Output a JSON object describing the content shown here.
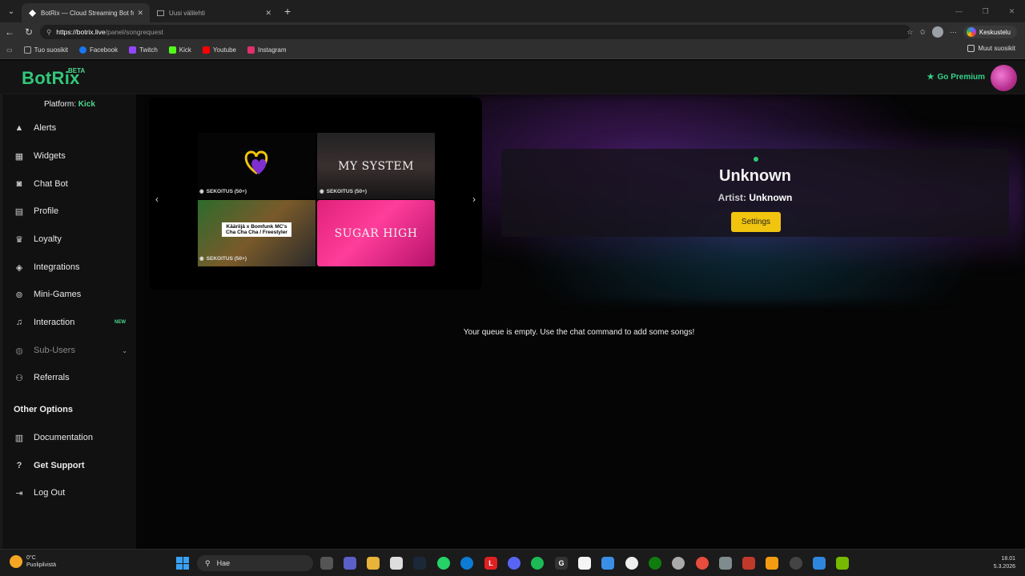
{
  "browser": {
    "tabs": [
      {
        "label": "BotRix — Cloud Streaming Bot for",
        "active": true
      },
      {
        "label": "Uusi välilehti",
        "active": false
      }
    ],
    "url_host": "https://botrix.live",
    "url_path": "/panel/songrequest",
    "chat_button": "Keskustelu",
    "bookmarks": [
      {
        "label": "Tuo suosikit",
        "icon": "import-icon",
        "color": "#aaaaaa"
      },
      {
        "label": "Facebook",
        "icon": "facebook-icon",
        "color": "#1877f2"
      },
      {
        "label": "Twitch",
        "icon": "twitch-icon",
        "color": "#9146ff"
      },
      {
        "label": "Kick",
        "icon": "kick-icon",
        "color": "#53fc18"
      },
      {
        "label": "Youtube",
        "icon": "youtube-icon",
        "color": "#ff0000"
      },
      {
        "label": "Instagram",
        "icon": "instagram-icon",
        "color": "#e1306c"
      }
    ],
    "other_bookmarks": "Muut suosikit"
  },
  "header": {
    "logo": "BotRix",
    "beta": "BETA",
    "premium": "Go Premium"
  },
  "sidebar": {
    "platform_label": "Platform:",
    "platform_value": "Kick",
    "items": [
      {
        "label": "Alerts",
        "icon": "warning-icon"
      },
      {
        "label": "Widgets",
        "icon": "grid-icon"
      },
      {
        "label": "Chat Bot",
        "icon": "robot-icon"
      },
      {
        "label": "Profile",
        "icon": "profile-card-icon"
      },
      {
        "label": "Loyalty",
        "icon": "trophy-icon"
      },
      {
        "label": "Integrations",
        "icon": "layers-icon"
      },
      {
        "label": "Mini-Games",
        "icon": "gamepad-icon"
      },
      {
        "label": "Interaction",
        "icon": "music-note-icon",
        "badge": "NEW"
      },
      {
        "label": "Sub-Users",
        "icon": "users-icon"
      },
      {
        "label": "Referrals",
        "icon": "people-icon"
      }
    ],
    "other_options_title": "Other Options",
    "other_items": [
      {
        "label": "Documentation",
        "icon": "book-icon"
      },
      {
        "label": "Get Support",
        "icon": "question-icon"
      },
      {
        "label": "Log Out",
        "icon": "logout-icon"
      }
    ]
  },
  "carousel": {
    "items": [
      {
        "caption": "SEKOITUS (50+)",
        "thumb_text": ""
      },
      {
        "caption": "SEKOITUS (50+)",
        "thumb_text": "MY SYSTEM"
      },
      {
        "caption": "SEKOITUS (50+)",
        "thumb_text": "Kääriijä x Bomfunk MC's Cha Cha Cha / Freestyler"
      },
      {
        "caption": "",
        "thumb_text": "SUGAR HIGH"
      }
    ]
  },
  "now_playing": {
    "title": "Unknown",
    "artist_label": "Artist:",
    "artist": "Unknown",
    "settings": "Settings"
  },
  "queue_message": "Your queue is empty. Use the chat command to add some songs!",
  "taskbar": {
    "weather_temp": "0°C",
    "weather_desc": "Puolipilvistä",
    "search": "Hae",
    "time": "18.01",
    "date": "5.3.2026"
  }
}
